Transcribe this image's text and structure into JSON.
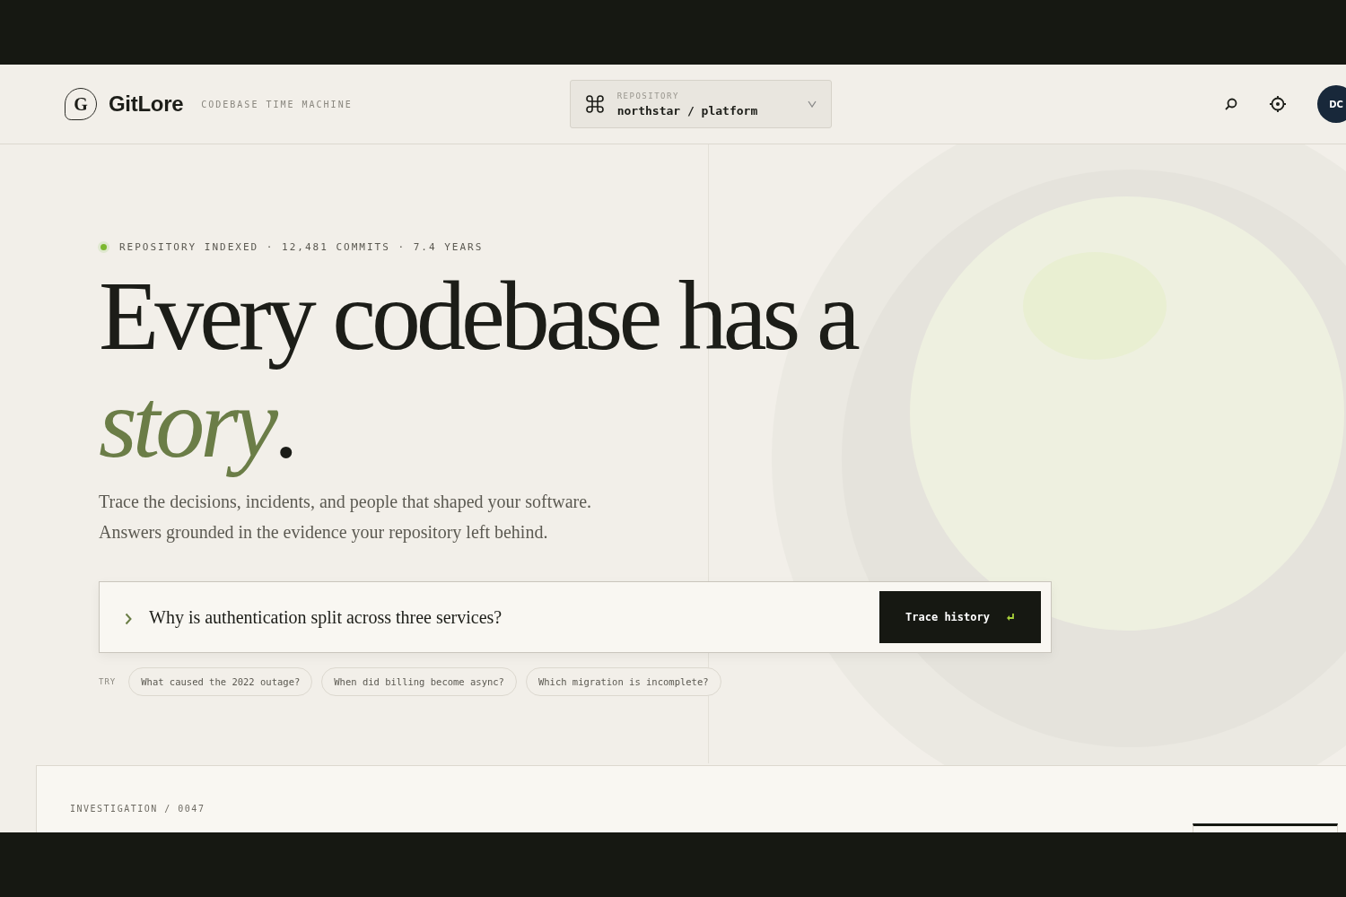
{
  "header": {
    "logo_letter": "G",
    "brand": "GitLore",
    "tagline": "CODEBASE TIME MACHINE",
    "repository": {
      "label": "REPOSITORY",
      "value": "northstar / platform"
    },
    "avatar": "DC"
  },
  "hero": {
    "status": {
      "indexed": true,
      "text": "REPOSITORY INDEXED · 12,481 COMMITS · 7.4 YEARS"
    },
    "headline": "Every codebase has a *story*.",
    "lines": [
      "Trace the decisions, incidents, and people that shaped your software.",
      "Answers grounded in the evidence your repository left behind."
    ],
    "question": {
      "value": "Why is authentication split across three services?",
      "button": "Trace history"
    },
    "try_label": "TRY",
    "suggestions": [
      "What caused the 2022 outage?",
      "When did billing become async?",
      "Which migration is incomplete?"
    ]
  },
  "investigation": {
    "label": "INVESTIGATION / 0047"
  }
}
